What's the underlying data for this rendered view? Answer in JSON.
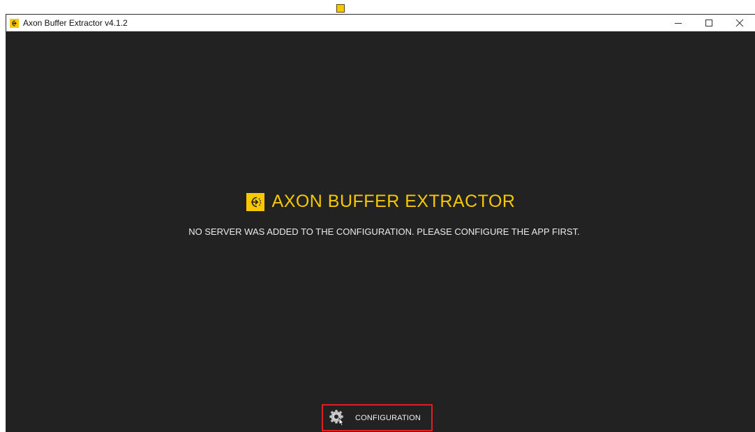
{
  "window": {
    "title": "Axon Buffer Extractor v4.1.2",
    "controls": {
      "minimize": "—",
      "maximize": "☐",
      "close": "✕"
    }
  },
  "brand": {
    "title": "AXON BUFFER EXTRACTOR"
  },
  "message": "NO SERVER WAS ADDED TO THE CONFIGURATION. PLEASE CONFIGURE THE APP FIRST.",
  "config_button": {
    "label": "CONFIGURATION",
    "icon": "gear-icon",
    "highlighted": true
  },
  "colors": {
    "accent": "#F6C800",
    "background": "#222222",
    "highlight_border": "#E0201E"
  }
}
